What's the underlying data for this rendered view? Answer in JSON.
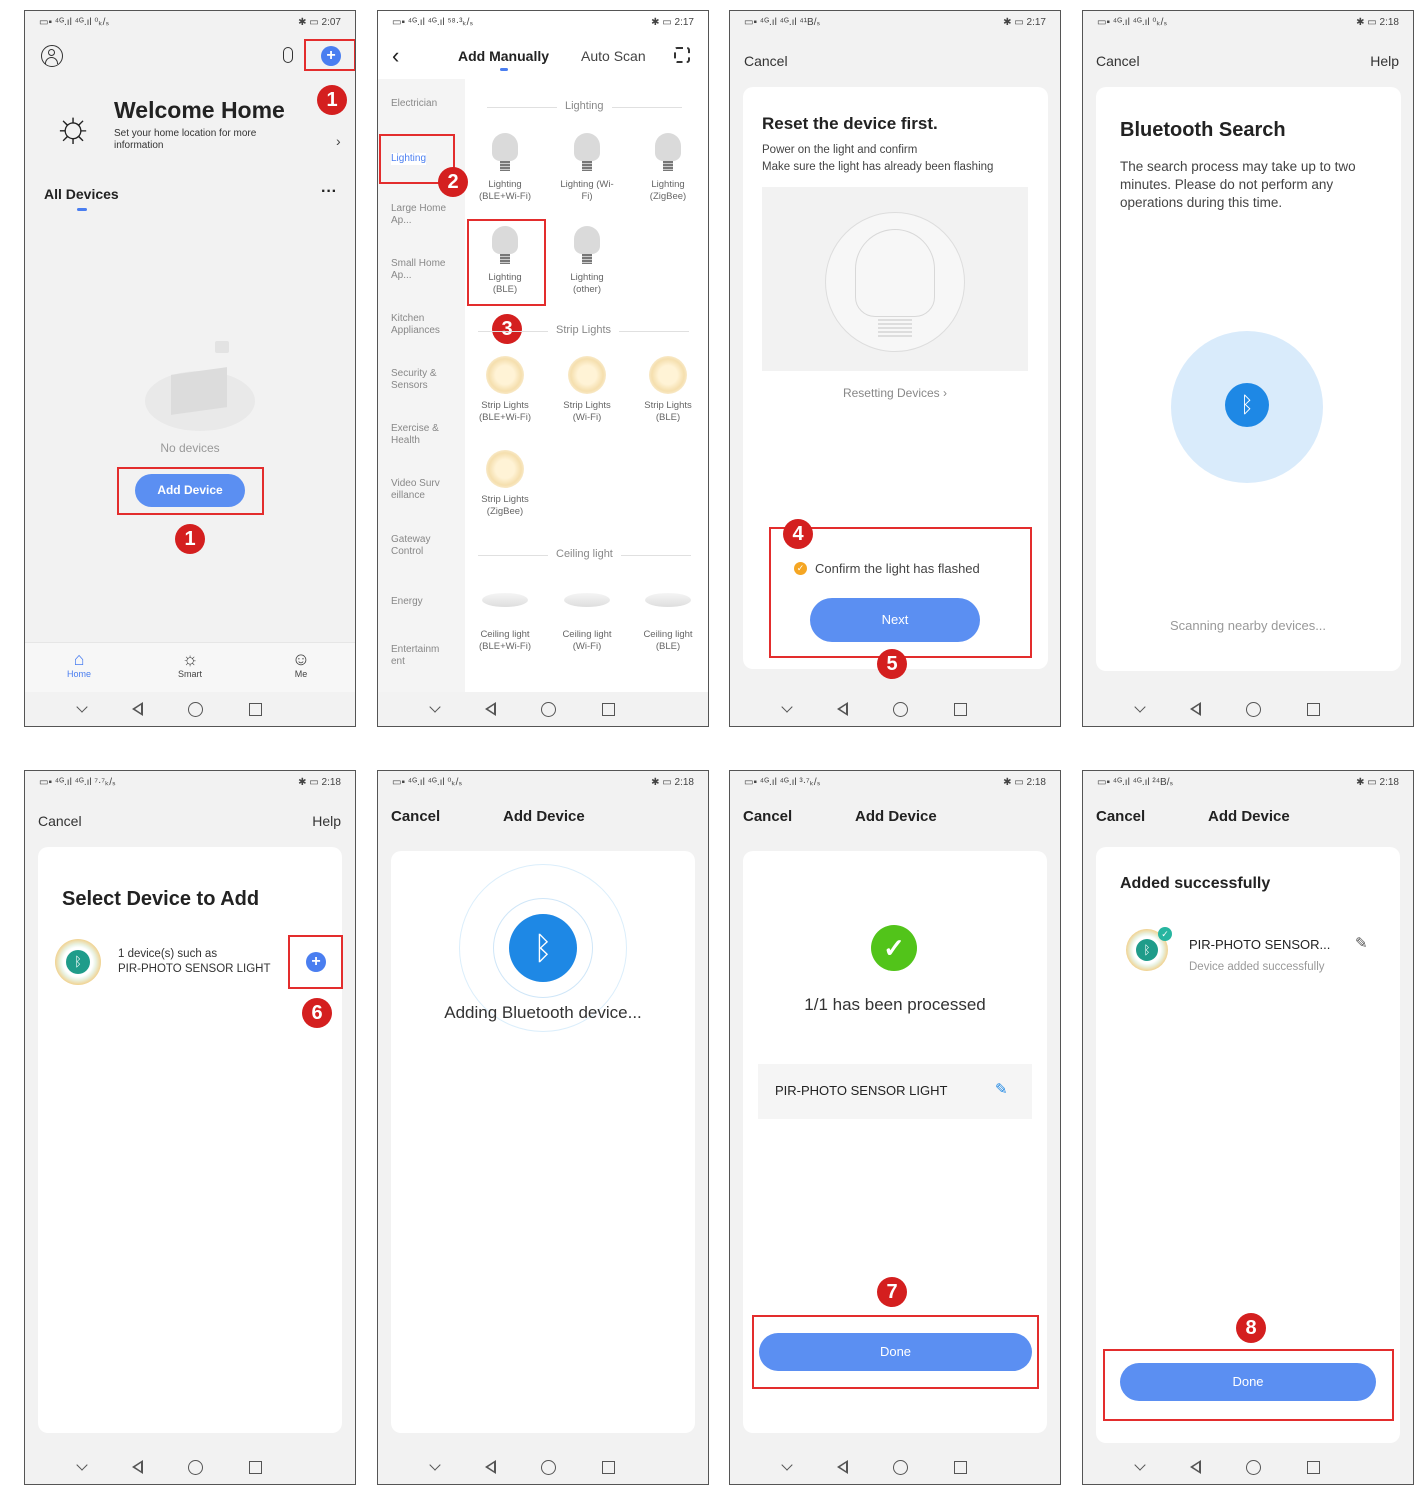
{
  "status": {
    "s1": {
      "left": "▭▪ ⁴ᴳ.ıl ⁴ᴳ.ıl ⁰ₖ/ₛ",
      "right": "✱ ▭ 2:07"
    },
    "s2": {
      "left": "▭▪ ⁴ᴳ.ıl ⁴ᴳ.ıl ⁵⁸·³ₖ/ₛ",
      "right": "✱ ▭ 2:17"
    },
    "s3": {
      "left": "▭▪ ⁴ᴳ.ıl ⁴ᴳ.ıl ⁴¹B/ₛ",
      "right": "✱ ▭ 2:17"
    },
    "s4": {
      "left": "▭▪ ⁴ᴳ.ıl ⁴ᴳ.ıl ⁰ₖ/ₛ",
      "right": "✱ ▭ 2:18"
    },
    "s5": {
      "left": "▭▪ ⁴ᴳ.ıl ⁴ᴳ.ıl ⁷·⁷ₖ/ₛ",
      "right": "✱ ▭ 2:18"
    },
    "s6": {
      "left": "▭▪ ⁴ᴳ.ıl ⁴ᴳ.ıl ⁰ₖ/ₛ",
      "right": "✱ ▭ 2:18"
    },
    "s7": {
      "left": "▭▪ ⁴ᴳ.ıl ⁴ᴳ.ıl ³·⁷ₖ/ₛ",
      "right": "✱ ▭ 2:18"
    },
    "s8": {
      "left": "▭▪ ⁴ᴳ.ıl ⁴ᴳ.ıl ²⁴B/ₛ",
      "right": "✱ ▭ 2:18"
    }
  },
  "badges": [
    "1",
    "2",
    "3",
    "4",
    "5",
    "6",
    "7",
    "8"
  ],
  "home": {
    "welcome_title": "Welcome Home",
    "welcome_sub": "Set your home location for more information",
    "all_devices": "All Devices",
    "more": "···",
    "no_devices": "No devices",
    "add_device": "Add Device",
    "tabs": [
      "Home",
      "Smart",
      "Me"
    ]
  },
  "manual": {
    "tab_manual": "Add Manually",
    "tab_scan": "Auto Scan",
    "categories": [
      "Electrician",
      "Lighting",
      "Large Home Ap...",
      "Small Home Ap...",
      "Kitchen Appliances",
      "Security & Sensors",
      "Exercise & Health",
      "Video Surv eillance",
      "Gateway Control",
      "Energy",
      "Entertainm ent"
    ],
    "sec_lighting": "Lighting",
    "lighting": [
      "Lighting (BLE+Wi-Fi)",
      "Lighting (Wi-Fi)",
      "Lighting (ZigBee)",
      "Lighting (BLE)",
      "Lighting (other)"
    ],
    "sec_strip": "Strip Lights",
    "strip": [
      "Strip Lights (BLE+Wi-Fi)",
      "Strip Lights (Wi-Fi)",
      "Strip Lights (BLE)",
      "Strip Lights (ZigBee)"
    ],
    "sec_ceiling": "Ceiling light",
    "ceiling": [
      "Ceiling light (BLE+Wi-Fi)",
      "Ceiling light (Wi-Fi)",
      "Ceiling light (BLE)"
    ]
  },
  "reset": {
    "cancel": "Cancel",
    "title": "Reset the device first.",
    "line1": "Power on the light and confirm",
    "line2": "Make sure the light has already been flashing",
    "link": "Resetting Devices",
    "confirm": "Confirm the light has flashed",
    "next": "Next"
  },
  "bt_search": {
    "cancel": "Cancel",
    "help": "Help",
    "title": "Bluetooth Search",
    "desc": "The search process may take up to two minutes. Please do not perform any operations during this time.",
    "scanning": "Scanning nearby devices..."
  },
  "select": {
    "cancel": "Cancel",
    "help": "Help",
    "title": "Select Device to Add",
    "line1": "1 device(s) such as",
    "line2": "PIR-PHOTO SENSOR LIGHT"
  },
  "adding": {
    "cancel": "Cancel",
    "title": "Add Device",
    "msg": "Adding Bluetooth device..."
  },
  "processed": {
    "cancel": "Cancel",
    "title": "Add Device",
    "msg": "1/1 has been processed",
    "device": "PIR-PHOTO SENSOR LIGHT",
    "done": "Done"
  },
  "success": {
    "cancel": "Cancel",
    "title": "Add Device",
    "heading": "Added successfully",
    "device": "PIR-PHOTO SENSOR...",
    "sub": "Device added successfully",
    "done": "Done"
  }
}
